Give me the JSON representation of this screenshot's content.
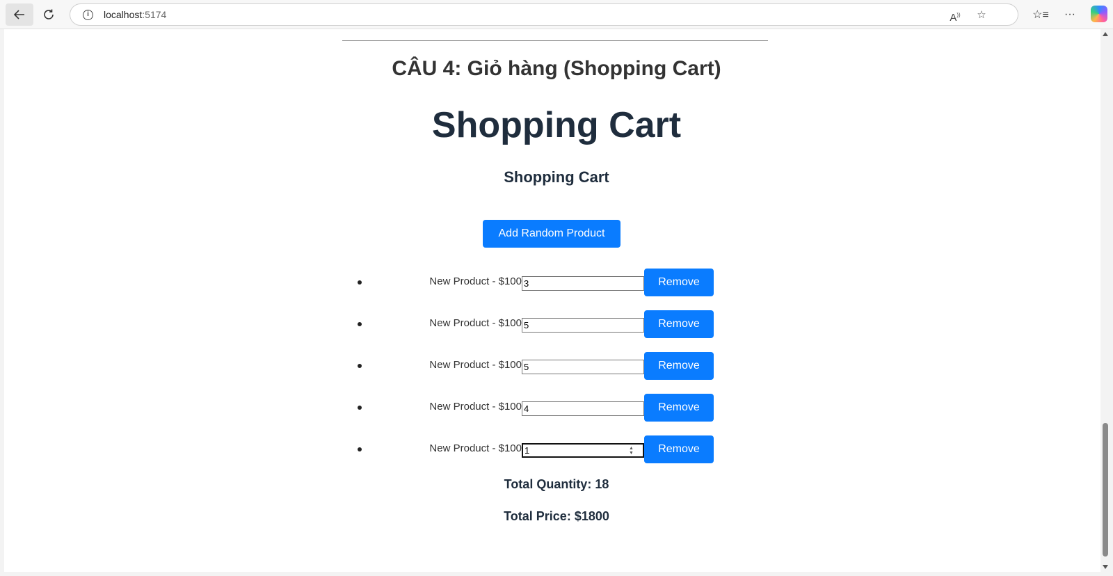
{
  "browser": {
    "url_host": "localhost",
    "url_port": ":5174",
    "icons": [
      "back-arrow-icon",
      "refresh-icon",
      "info-icon",
      "read-aloud-icon",
      "favorite-star-icon",
      "favorites-list-icon",
      "more-icon",
      "copilot-icon"
    ]
  },
  "page": {
    "section_title": "CÂU 4: Giỏ hàng (Shopping Cart)",
    "main_title": "Shopping Cart",
    "sub_title": "Shopping Cart",
    "add_button": "Add Random Product",
    "remove_label": "Remove",
    "items": [
      {
        "name": "New Product - $100",
        "qty": "3"
      },
      {
        "name": "New Product - $100",
        "qty": "5"
      },
      {
        "name": "New Product - $100",
        "qty": "5"
      },
      {
        "name": "New Product - $100",
        "qty": "4"
      },
      {
        "name": "New Product - $100",
        "qty": "1"
      }
    ],
    "total_quantity": "Total Quantity: 18",
    "total_price": "Total Price: $1800"
  },
  "colors": {
    "primary": "#0a7cff",
    "heading": "#1f2d3d"
  }
}
